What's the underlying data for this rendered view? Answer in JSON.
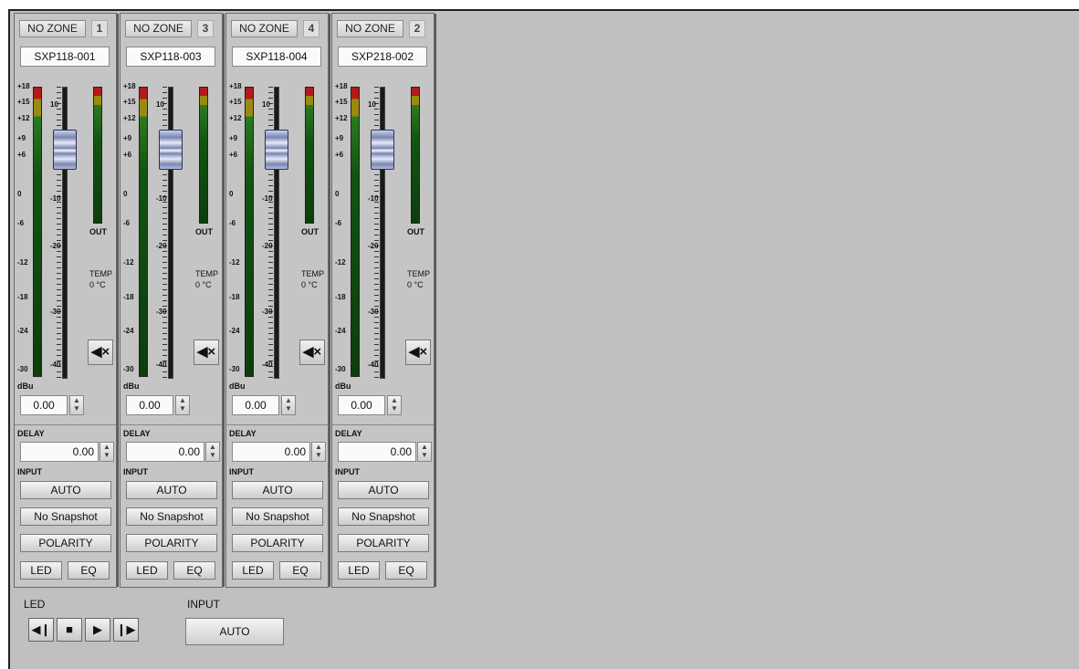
{
  "input_meter_scale": [
    "+18",
    "+15",
    "+12",
    "+9",
    "+6",
    "0",
    "-6",
    "-12",
    "-18",
    "-24",
    "-30"
  ],
  "fader_scale": [
    "10",
    "-10",
    "-20",
    "-30",
    "-40"
  ],
  "units_label": "dBu",
  "out_label": "OUT",
  "temp_label": "TEMP",
  "mute_icon": "speaker-mute-icon",
  "delay_label": "DELAY",
  "input_label": "INPUT",
  "channels": [
    {
      "zone": "NO ZONE",
      "number": "1",
      "name": "SXP118-001",
      "temp": "0 °C",
      "gain": "0.00",
      "delay": "0.00",
      "input": "AUTO",
      "snapshot": "No Snapshot",
      "polarity": "POLARITY",
      "led": "LED",
      "eq": "EQ"
    },
    {
      "zone": "NO ZONE",
      "number": "3",
      "name": "SXP118-003",
      "temp": "0 °C",
      "gain": "0.00",
      "delay": "0.00",
      "input": "AUTO",
      "snapshot": "No Snapshot",
      "polarity": "POLARITY",
      "led": "LED",
      "eq": "EQ"
    },
    {
      "zone": "NO ZONE",
      "number": "4",
      "name": "SXP118-004",
      "temp": "0 °C",
      "gain": "0.00",
      "delay": "0.00",
      "input": "AUTO",
      "snapshot": "No Snapshot",
      "polarity": "POLARITY",
      "led": "LED",
      "eq": "EQ"
    },
    {
      "zone": "NO ZONE",
      "number": "2",
      "name": "SXP218-002",
      "temp": "0 °C",
      "gain": "0.00",
      "delay": "0.00",
      "input": "AUTO",
      "snapshot": "No Snapshot",
      "polarity": "POLARITY",
      "led": "LED",
      "eq": "EQ"
    }
  ],
  "bottom": {
    "led_label": "LED",
    "input_label": "INPUT",
    "input_value": "AUTO",
    "transport_icons": [
      "skip-back-icon",
      "stop-icon",
      "play-icon",
      "skip-forward-icon"
    ]
  },
  "colors": {
    "meter_red": "#b21a1a",
    "meter_yellow": "#9a8a10",
    "meter_green": "#125412",
    "fader_knob": "#7a86b0",
    "panel_bg": "#c0c0c0"
  }
}
